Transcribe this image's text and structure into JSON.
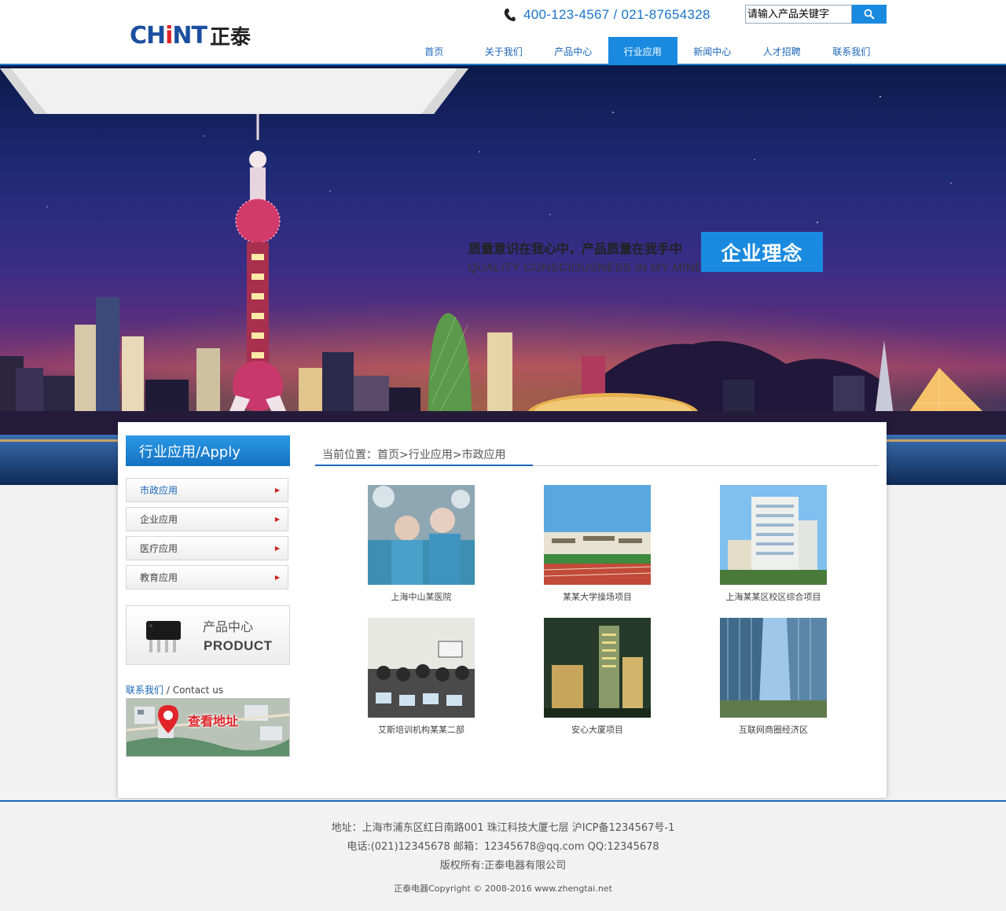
{
  "brand": {
    "logo_en_a": "CH",
    "logo_en_b": "i",
    "logo_en_c": "NT",
    "logo_cn": "正泰"
  },
  "header": {
    "hotline": "400-123-4567 / 021-87654328",
    "search_placeholder": "请输入产品关键字",
    "icons": {
      "phone": "phone-icon",
      "search": "search-icon"
    }
  },
  "nav": {
    "items": [
      "首页",
      "关于我们",
      "产品中心",
      "行业应用",
      "新闻中心",
      "人才招聘",
      "联系我们"
    ],
    "active_index": 3
  },
  "banner": {
    "slogan_cn": "质量意识在我心中，产品质量在我手中",
    "slogan_en": "QUALITY CONSCIOUSNESS IN MY MIND",
    "tag": "企业理念"
  },
  "sidebar": {
    "title": "行业应用/Apply",
    "items": [
      "市政应用",
      "企业应用",
      "医疗应用",
      "教育应用"
    ],
    "active_index": 0,
    "product_cn": "产品中心",
    "product_en": "PRODUCT",
    "contact_cn": "联系我们",
    "contact_en": " / Contact us",
    "map_label": "查看地址"
  },
  "breadcrumb": {
    "text": "当前位置：首页>行业应用>市政应用"
  },
  "projects": [
    "上海中山某医院",
    "某某大学操场项目",
    "上海某某区校区综合项目",
    "艾斯培训机构某某二部",
    "安心大厦项目",
    "互联网商圈经济区"
  ],
  "footer": {
    "address": "地址：上海市浦东区红日南路001 珠江科技大厦七层 沪ICP备1234567号-1",
    "contact": "电话:(021)12345678 邮箱：12345678@qq.com QQ:12345678",
    "rights": "版权所有:正泰电器有限公司",
    "copyright": "正泰电器Copyright © 2008-2016   www.zhengtai.net"
  },
  "colors": {
    "accent": "#1a8ae0",
    "nav_text": "#1a66b8",
    "logo_blue": "#1c4f9f",
    "logo_red": "#e0242a"
  }
}
